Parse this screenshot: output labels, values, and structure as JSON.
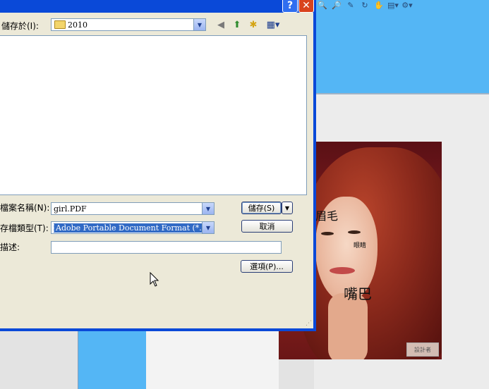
{
  "dialog": {
    "save_in_label": "儲存於(I):",
    "save_in_value": "2010",
    "filename_label": "檔案名稱(N):",
    "filename_value": "girl.PDF",
    "filetype_label": "存檔類型(T):",
    "filetype_value": "Adobe Portable Document Format (*.pdf)",
    "description_label": "描述:",
    "save_button": "儲存(S)",
    "cancel_button": "取消",
    "options_button": "選項(P)...",
    "help_glyph": "?",
    "close_glyph": "✕"
  },
  "photo": {
    "label_eyebrow": "眉毛",
    "label_eye": "眼睛",
    "label_mouth": "嘴巴",
    "watermark": "設計者"
  },
  "icons": [
    "search-icon",
    "zoom-icon",
    "edit-icon",
    "rotate-icon",
    "hand-icon",
    "page-icon",
    "view-icon"
  ],
  "colors": {
    "title_bar": "#0a49d8",
    "dialog_bg": "#ece9d8",
    "app_blue": "#54b6f5",
    "selection": "#316ac5"
  }
}
